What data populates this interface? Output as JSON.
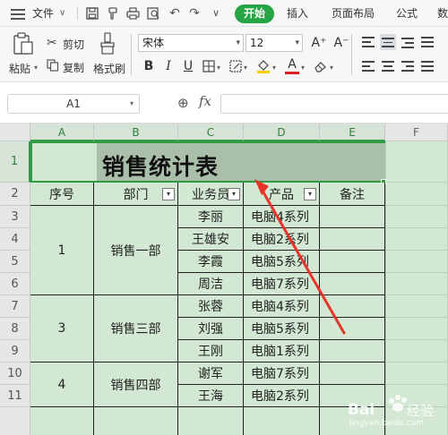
{
  "menubar": {
    "file_label": "文件",
    "tabs": [
      {
        "label": "开始",
        "active": true
      },
      {
        "label": "插入"
      },
      {
        "label": "页面布局"
      },
      {
        "label": "公式"
      },
      {
        "label": "数"
      }
    ],
    "quick_access_icons": [
      "save-icon",
      "format-painter-icon",
      "print-icon",
      "print-preview-icon",
      "undo-icon",
      "redo-icon",
      "chevron-down-icon"
    ]
  },
  "ribbon": {
    "paste_label": "粘贴",
    "cut_label": "剪切",
    "copy_label": "复制",
    "format_painter_label": "格式刷",
    "font_name": "宋体",
    "font_size": "12",
    "increase_font_glyph": "A⁺",
    "decrease_font_glyph": "A⁻",
    "bold_glyph": "B",
    "italic_glyph": "I",
    "underline_glyph": "U",
    "font_color_glyph": "A",
    "accent_color": "#27a544"
  },
  "formula_bar": {
    "name_box": "A1",
    "fx_glyph": "fx",
    "zoom_glyph": "⊕"
  },
  "sheet": {
    "columns": [
      "A",
      "B",
      "C",
      "D",
      "E",
      "F"
    ],
    "rows": [
      "1",
      "2",
      "3",
      "4",
      "5",
      "6",
      "7",
      "8",
      "9",
      "10",
      "11"
    ],
    "title": "销售统计表",
    "headers": [
      "序号",
      "部门",
      "业务员",
      "产品",
      "备注"
    ],
    "groups": [
      {
        "index": "1",
        "dept": "销售一部"
      },
      {
        "index": "3",
        "dept": "销售三部"
      },
      {
        "index": "4",
        "dept": "销售四部"
      }
    ],
    "staff": [
      {
        "name": "李丽",
        "product": "电脑4系列"
      },
      {
        "name": "王雄安",
        "product": "电脑2系列"
      },
      {
        "name": "李霞",
        "product": "电脑5系列"
      },
      {
        "name": "周洁",
        "product": "电脑7系列"
      },
      {
        "name": "张蓉",
        "product": "电脑4系列"
      },
      {
        "name": "刘强",
        "product": "电脑5系列"
      },
      {
        "name": "王刚",
        "product": "电脑1系列"
      },
      {
        "name": "谢军",
        "product": "电脑7系列"
      },
      {
        "name": "王海",
        "product": "电脑2系列"
      }
    ],
    "filter_glyph": "▾",
    "sheet_bg": "#d2e8d3",
    "selection_color": "#2f9b45"
  },
  "annotation": {
    "arrow_color": "#e8332b"
  },
  "watermark": {
    "brand": "Bai",
    "brand_suffix": "经验",
    "url": "jingyan.baidu.com"
  }
}
